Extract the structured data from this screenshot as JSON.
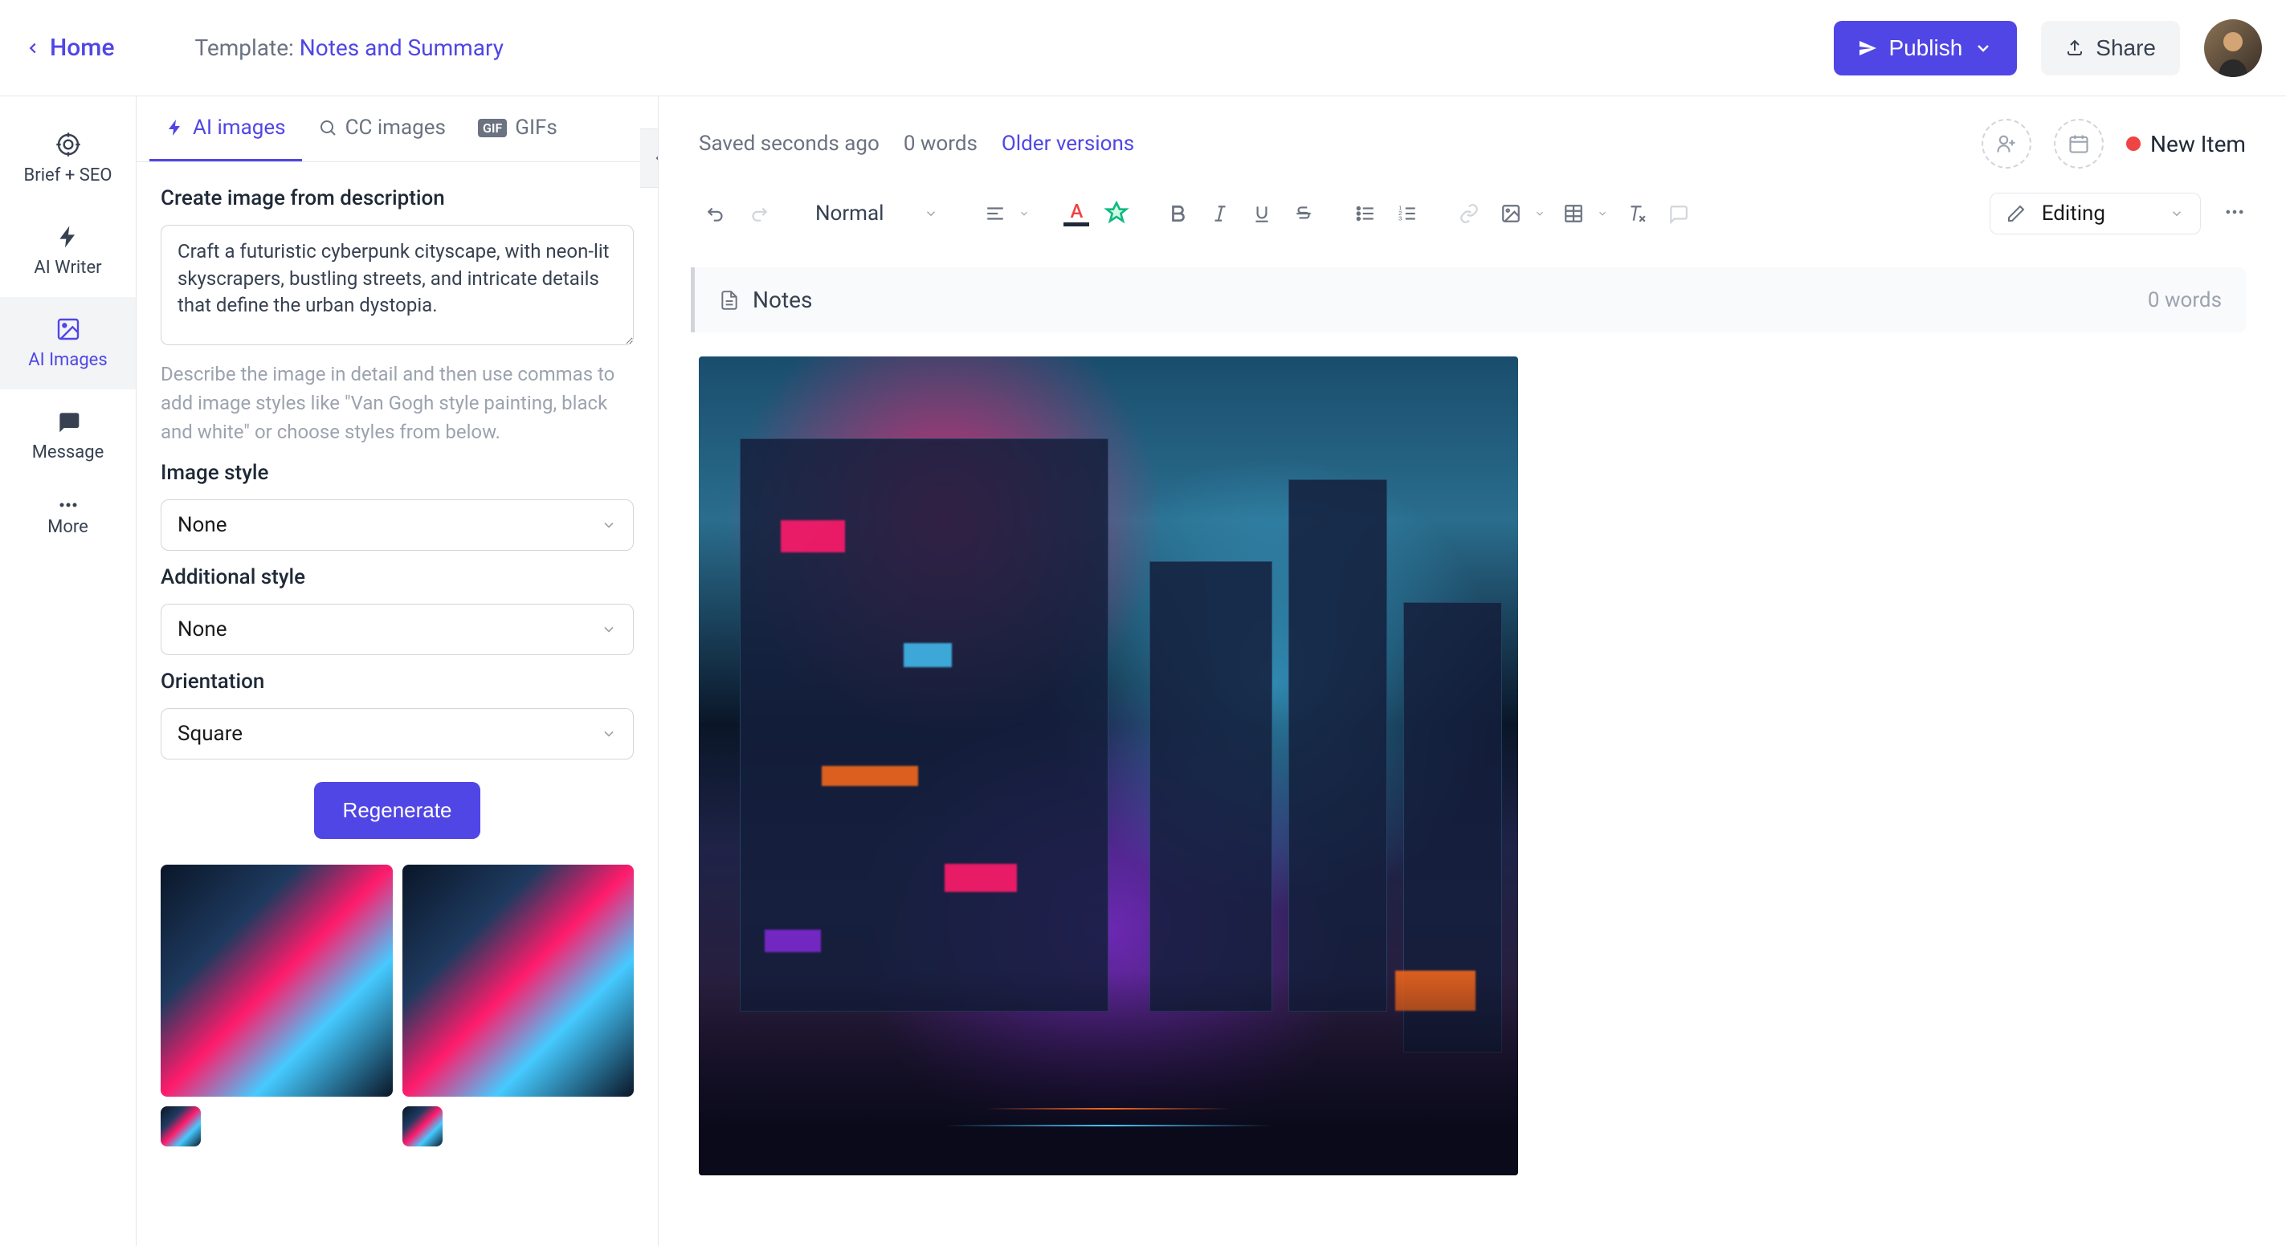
{
  "topbar": {
    "home": "Home",
    "template_prefix": "Template: ",
    "template_name": "Notes and Summary",
    "publish": "Publish",
    "share": "Share"
  },
  "rail": {
    "brief_seo": "Brief + SEO",
    "ai_writer": "AI Writer",
    "ai_images": "AI Images",
    "message": "Message",
    "more": "More"
  },
  "panel": {
    "tabs": {
      "ai_images": "AI images",
      "cc_images": "CC images",
      "gifs": "GIFs"
    },
    "create_label": "Create image from description",
    "prompt_value": "Craft a futuristic cyberpunk cityscape, with neon-lit skyscrapers, bustling streets, and intricate details that define the urban dystopia.",
    "hint": "Describe the image in detail and then use commas to add image styles like \"Van Gogh style painting, black and white\" or choose styles from below.",
    "image_style_label": "Image style",
    "image_style_value": "None",
    "additional_style_label": "Additional style",
    "additional_style_value": "None",
    "orientation_label": "Orientation",
    "orientation_value": "Square",
    "regenerate": "Regenerate"
  },
  "editor": {
    "saved": "Saved seconds ago",
    "word_count_top": "0 words",
    "older_versions": "Older versions",
    "new_item": "New Item",
    "toolbar": {
      "paragraph_style": "Normal",
      "editing_mode": "Editing"
    },
    "notes_section": {
      "title": "Notes",
      "word_count": "0 words"
    }
  }
}
